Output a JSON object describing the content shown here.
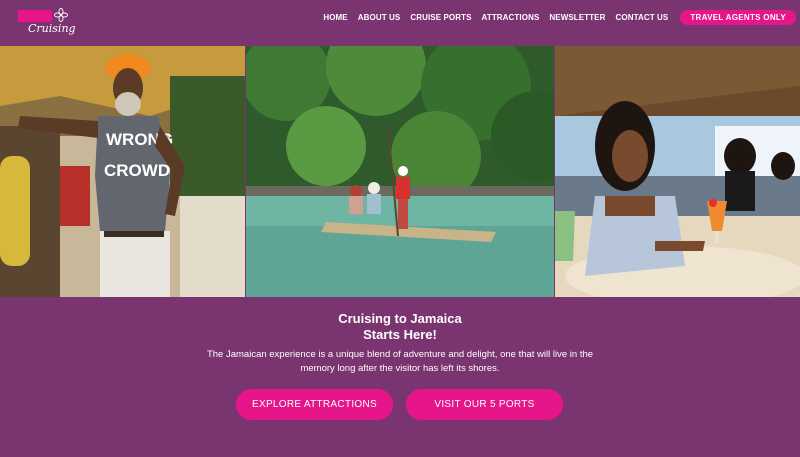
{
  "brand": {
    "logo_script": "Cruising",
    "logo_color": "#e6168a"
  },
  "nav": {
    "items": [
      "HOME",
      "ABOUT US",
      "CRUISE PORTS",
      "ATTRACTIONS",
      "NEWSLETTER",
      "CONTACT US"
    ],
    "cta": "TRAVEL AGENTS ONLY"
  },
  "photos": [
    {
      "subject": "man-wearing-orange-hat",
      "shirt_text_line1": "WRONG",
      "shirt_text_line2": "CROWD"
    },
    {
      "subject": "bamboo-raft-on-river"
    },
    {
      "subject": "woman-at-beach-bar"
    }
  ],
  "hero": {
    "title_line1": "Cruising to Jamaica",
    "title_line2": "Starts Here!",
    "description": "The Jamaican experience is a unique blend of adventure and delight, one that will live in the memory long after the visitor has left its shores.",
    "button_primary": "EXPLORE ATTRACTIONS",
    "button_secondary": "VISIT OUR 5 PORTS"
  },
  "colors": {
    "background": "#7a3470",
    "accent": "#e6168a",
    "text": "#ffffff"
  }
}
